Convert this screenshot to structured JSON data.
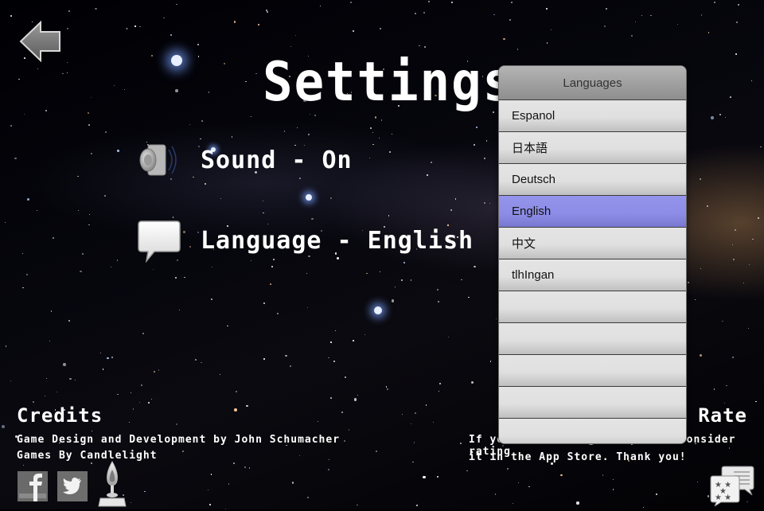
{
  "header": {
    "title": "Settings"
  },
  "settings": {
    "sound_label": "Sound - On",
    "language_label": "Language - English"
  },
  "credits": {
    "title": "Credits",
    "line1": "Game Design and Development by John Schumacher",
    "line2": "Games By Candlelight"
  },
  "rate": {
    "title": "Rate",
    "line1": "If you like this game, please consider rating",
    "line2": "it in the App Store.  Thank you!"
  },
  "language_popover": {
    "title": "Languages",
    "selected": "English",
    "items": [
      {
        "label": "Espanol"
      },
      {
        "label": "日本語"
      },
      {
        "label": "Deutsch"
      },
      {
        "label": "English"
      },
      {
        "label": "中文"
      },
      {
        "label": "tlhIngan"
      },
      {
        "label": ""
      },
      {
        "label": ""
      },
      {
        "label": ""
      },
      {
        "label": ""
      },
      {
        "label": ""
      }
    ],
    "selected_color": "#8c8ce6"
  },
  "icons": {
    "back": "back-arrow-icon",
    "sound": "speaker-icon",
    "language": "speech-bubble-icon",
    "facebook": "facebook-icon",
    "twitter": "twitter-icon",
    "candle": "candle-icon",
    "rate": "rating-stars-icon"
  }
}
